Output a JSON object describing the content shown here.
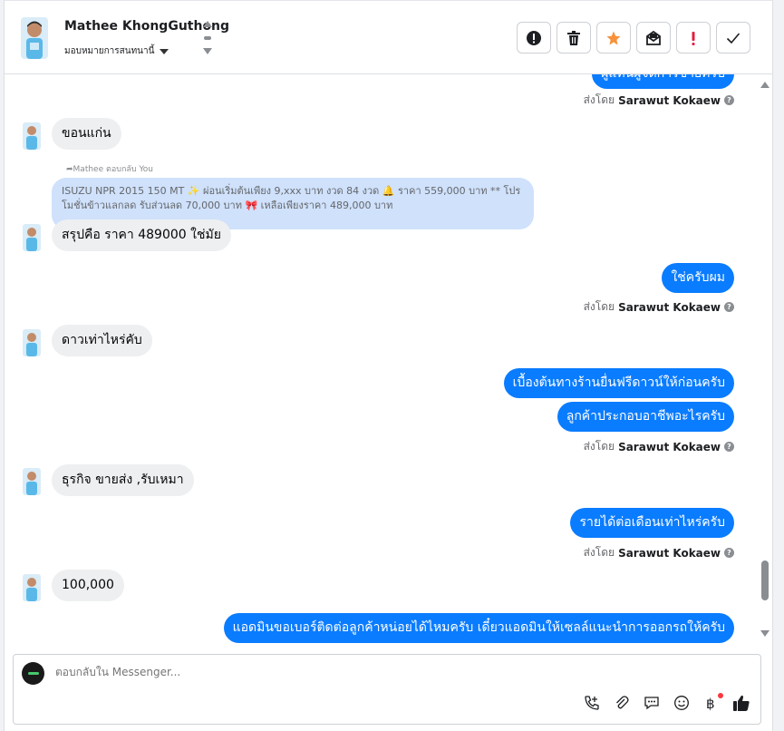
{
  "header": {
    "name": "Mathee KhongGuthong",
    "assign_label": "มอบหมายการสนทนานี้"
  },
  "actions": [
    {
      "name": "mark-spam-button",
      "icon": "alert-circle-icon"
    },
    {
      "name": "delete-button",
      "icon": "trash-icon"
    },
    {
      "name": "star-button",
      "icon": "star-icon",
      "color": "#f7923b"
    },
    {
      "name": "mark-unread-button",
      "icon": "envelope-icon"
    },
    {
      "name": "follow-up-button",
      "icon": "exclamation-icon",
      "color": "#e41e3f"
    },
    {
      "name": "mark-done-button",
      "icon": "checkmark-icon"
    }
  ],
  "chat": {
    "messages": [
      {
        "dir": "out",
        "text": "ผู้แทนผู้จัดการขายครับ"
      },
      {
        "dir": "meta",
        "prefix": "ส่งโดย",
        "sender": "Sarawut Kokaew"
      },
      {
        "dir": "in",
        "text": "ขอนแก่น"
      },
      {
        "dir": "reply",
        "label": "Mathee ตอบกลับ You",
        "quote": "ISUZU NPR 2015 150 MT ✨ ผ่อนเริ่มต้นเพียง 9,xxx บาท งวด 84 งวด 🔔 ราคา 559,000 บาท ** โปรโมชั่นข้าวแลกลด รับส่วนลด 70,000 บาท 🎀 เหลือเพียงราคา 489,000 บาท"
      },
      {
        "dir": "in",
        "text": "สรุปคือ ราคา 489000 ใช่มัย"
      },
      {
        "dir": "out",
        "text": "ใช่ครับผม"
      },
      {
        "dir": "meta",
        "prefix": "ส่งโดย",
        "sender": "Sarawut Kokaew"
      },
      {
        "dir": "in",
        "text": "ดาวเท่าไหร่คับ"
      },
      {
        "dir": "out",
        "text": "เบื้องต้นทางร้านยื่นฟรีดาวน์ให้ก่อนครับ"
      },
      {
        "dir": "out",
        "text": "ลูกค้าประกอบอาชีพอะไรครับ"
      },
      {
        "dir": "meta",
        "prefix": "ส่งโดย",
        "sender": "Sarawut Kokaew"
      },
      {
        "dir": "in",
        "text": "ธุรกิจ ขายส่ง ,รับเหมา"
      },
      {
        "dir": "out",
        "text": "รายได้ต่อเดือนเท่าไหร่ครับ"
      },
      {
        "dir": "meta",
        "prefix": "ส่งโดย",
        "sender": "Sarawut Kokaew"
      },
      {
        "dir": "in",
        "text": "100,000"
      },
      {
        "dir": "out",
        "text": "แอดมินขอเบอร์ติดต่อลูกค้าหน่อยได้ไหมครับ เดี๋ยวแอดมินให้เซลล์แนะนำการออกรถให้ครับ"
      }
    ]
  },
  "composer": {
    "placeholder": "ตอบกลับใน Messenger...",
    "tools": [
      "phone-plus-icon",
      "paperclip-icon",
      "saved-reply-icon",
      "emoji-icon",
      "baht-icon",
      "thumbs-up-icon"
    ]
  },
  "colors": {
    "outgoing_bubble": "#0a7cff",
    "incoming_bubble": "#eeeff1",
    "reply_quote": "#cfe1fb"
  }
}
